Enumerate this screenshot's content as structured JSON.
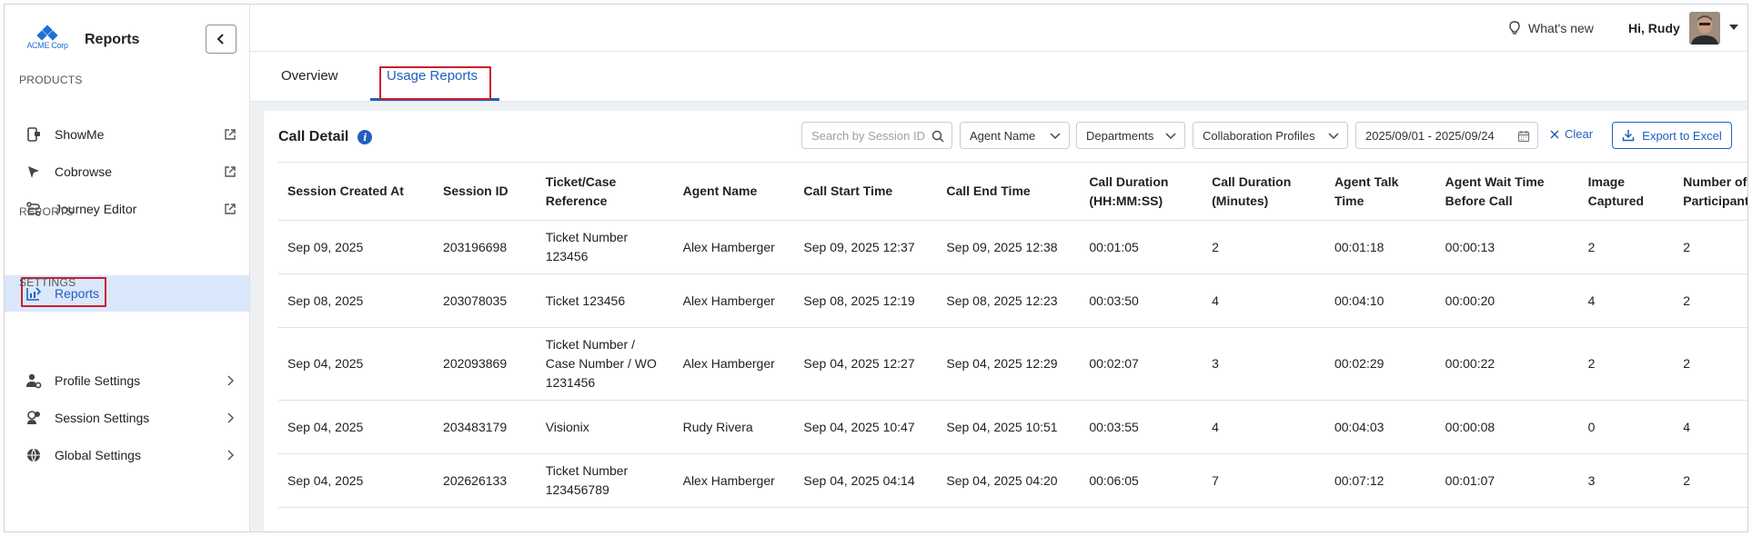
{
  "app": {
    "title": "Reports",
    "logo_text": "ACME Corp",
    "brand_color": "#1d6fd6"
  },
  "sidebar": {
    "sections": {
      "products": "PRODUCTS",
      "reports": "REPORTS",
      "settings": "SETTINGS"
    },
    "products": [
      {
        "label": "ShowMe",
        "icon": "showme-icon",
        "trailing": "external-link-icon"
      },
      {
        "label": "Cobrowse",
        "icon": "cobrowse-cursor-icon",
        "trailing": "external-link-icon"
      },
      {
        "label": "Journey Editor",
        "icon": "journey-route-icon",
        "trailing": "external-link-icon"
      }
    ],
    "reports": [
      {
        "label": "Reports",
        "icon": "reports-chart-icon",
        "active": true
      }
    ],
    "settings": [
      {
        "label": "Profile Settings",
        "icon": "profile-gear-icon",
        "trailing": "chevron-right-icon"
      },
      {
        "label": "Session Settings",
        "icon": "session-settings-icon",
        "trailing": "chevron-right-icon"
      },
      {
        "label": "Global Settings",
        "icon": "globe-icon",
        "trailing": "chevron-right-icon"
      }
    ]
  },
  "header": {
    "whats_new": "What's new",
    "greeting": "Hi, Rudy"
  },
  "tabs": [
    {
      "label": "Overview",
      "active": false
    },
    {
      "label": "Usage Reports",
      "active": true
    }
  ],
  "card": {
    "title": "Call Detail",
    "filters": {
      "search_placeholder": "Search by Session ID",
      "agent_name": "Agent Name",
      "departments": "Departments",
      "collaboration_profiles": "Collaboration Profiles",
      "date_range": "2025/09/01 - 2025/09/24",
      "clear": "Clear",
      "export": "Export to Excel"
    }
  },
  "table": {
    "headers": [
      "Session Created At",
      "Session ID",
      "Ticket/Case Reference",
      "Agent Name",
      "Call Start Time",
      "Call End Time",
      "Call Duration (HH:MM:SS)",
      "Call Duration (Minutes)",
      "Agent Talk Time",
      "Agent Wait Time Before Call",
      "Image Captured",
      "Number of Participants"
    ],
    "rows": [
      [
        "Sep 09, 2025",
        "203196698",
        "Ticket Number 123456",
        "Alex Hamberger",
        "Sep 09, 2025 12:37",
        "Sep 09, 2025 12:38",
        "00:01:05",
        "2",
        "00:01:18",
        "00:00:13",
        "2",
        "2"
      ],
      [
        "Sep 08, 2025",
        "203078035",
        "Ticket 123456",
        "Alex Hamberger",
        "Sep 08, 2025 12:19",
        "Sep 08, 2025 12:23",
        "00:03:50",
        "4",
        "00:04:10",
        "00:00:20",
        "4",
        "2"
      ],
      [
        "Sep 04, 2025",
        "202093869",
        "Ticket Number / Case Number / WO 1231456",
        "Alex Hamberger",
        "Sep 04, 2025 12:27",
        "Sep 04, 2025 12:29",
        "00:02:07",
        "3",
        "00:02:29",
        "00:00:22",
        "2",
        "2"
      ],
      [
        "Sep 04, 2025",
        "203483179",
        "Visionix",
        "Rudy Rivera",
        "Sep 04, 2025 10:47",
        "Sep 04, 2025 10:51",
        "00:03:55",
        "4",
        "00:04:03",
        "00:00:08",
        "0",
        "4"
      ],
      [
        "Sep 04, 2025",
        "202626133",
        "Ticket Number 123456789",
        "Alex Hamberger",
        "Sep 04, 2025 04:14",
        "Sep 04, 2025 04:20",
        "00:06:05",
        "7",
        "00:07:12",
        "00:01:07",
        "3",
        "2"
      ]
    ]
  },
  "colors": {
    "accent": "#1f5fbf",
    "active_nav_bg": "#dbe7fb",
    "highlight_box": "#c8202f"
  }
}
